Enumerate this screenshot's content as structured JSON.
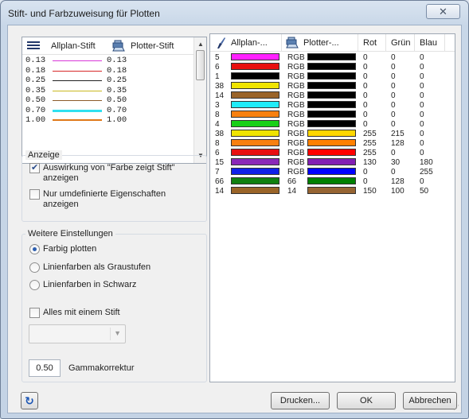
{
  "window": {
    "title": "Stift- und Farbzuweisung für Plotten",
    "close_glyph": "✕"
  },
  "pen_list": {
    "col_allplan": "Allplan-Stift",
    "col_plotter": "Plotter-Stift",
    "rows": [
      {
        "a": "0.13",
        "b": "0.13",
        "color": "#d838d8",
        "w": 1
      },
      {
        "a": "0.18",
        "b": "0.18",
        "color": "#d82828",
        "w": 1
      },
      {
        "a": "0.25",
        "b": "0.25",
        "color": "#222222",
        "w": 1
      },
      {
        "a": "0.35",
        "b": "0.35",
        "color": "#c8b820",
        "w": 1
      },
      {
        "a": "0.50",
        "b": "0.50",
        "color": "#8b5a2b",
        "w": 1
      },
      {
        "a": "0.70",
        "b": "0.70",
        "color": "#30e0f0",
        "w": 3
      },
      {
        "a": "1.00",
        "b": "1.00",
        "color": "#e07818",
        "w": 2
      }
    ]
  },
  "display_group": {
    "title": "Anzeige",
    "opt1": "Auswirkung von \"Farbe zeigt Stift\"",
    "opt1b": "anzeigen",
    "opt1_checked": true,
    "opt2": "Nur umdefinierte Eigenschaften",
    "opt2b": "anzeigen",
    "opt2_checked": false
  },
  "settings_group": {
    "title": "Weitere Einstellungen",
    "radio1": "Farbig plotten",
    "radio2": "Linienfarben als Graustufen",
    "radio3": "Linienfarben in Schwarz",
    "selected": "Farbig plotten",
    "single_pen": "Alles mit einem Stift",
    "gamma_value": "0.50",
    "gamma_label": "Gammakorrektur"
  },
  "table": {
    "headers": {
      "allplan": "Allplan-...",
      "plotter": "Plotter-...",
      "rot": "Rot",
      "gruen": "Grün",
      "blau": "Blau"
    },
    "rows": [
      {
        "pen": "5",
        "color": "#ff20ff",
        "mode": "RGB",
        "pcolor": "#000000",
        "r": "0",
        "g": "0",
        "b": "0"
      },
      {
        "pen": "6",
        "color": "#e81010",
        "mode": "RGB",
        "pcolor": "#000000",
        "r": "0",
        "g": "0",
        "b": "0"
      },
      {
        "pen": "1",
        "color": "#000000",
        "mode": "RGB",
        "pcolor": "#000000",
        "r": "0",
        "g": "0",
        "b": "0"
      },
      {
        "pen": "38",
        "color": "#f0e400",
        "mode": "RGB",
        "pcolor": "#000000",
        "r": "0",
        "g": "0",
        "b": "0"
      },
      {
        "pen": "14",
        "color": "#9a6428",
        "mode": "RGB",
        "pcolor": "#000000",
        "r": "0",
        "g": "0",
        "b": "0"
      },
      {
        "pen": "3",
        "color": "#20ecf8",
        "mode": "RGB",
        "pcolor": "#000000",
        "r": "0",
        "g": "0",
        "b": "0"
      },
      {
        "pen": "8",
        "color": "#f88010",
        "mode": "RGB",
        "pcolor": "#000000",
        "r": "0",
        "g": "0",
        "b": "0"
      },
      {
        "pen": "4",
        "color": "#18d018",
        "mode": "RGB",
        "pcolor": "#000000",
        "r": "0",
        "g": "0",
        "b": "0"
      },
      {
        "pen": "38",
        "color": "#f0e400",
        "mode": "RGB",
        "pcolor": "#ffd700",
        "r": "255",
        "g": "215",
        "b": "0"
      },
      {
        "pen": "8",
        "color": "#f88010",
        "mode": "RGB",
        "pcolor": "#ff8000",
        "r": "255",
        "g": "128",
        "b": "0"
      },
      {
        "pen": "6",
        "color": "#e81010",
        "mode": "RGB",
        "pcolor": "#ff0000",
        "r": "255",
        "g": "0",
        "b": "0"
      },
      {
        "pen": "15",
        "color": "#8a28b8",
        "mode": "RGB",
        "pcolor": "#821eb4",
        "r": "130",
        "g": "30",
        "b": "180"
      },
      {
        "pen": "7",
        "color": "#1020e8",
        "mode": "RGB",
        "pcolor": "#0000ff",
        "r": "0",
        "g": "0",
        "b": "255"
      },
      {
        "pen": "66",
        "color": "#108010",
        "mode": "66",
        "pcolor": "#008000",
        "r": "0",
        "g": "128",
        "b": "0"
      },
      {
        "pen": "14",
        "color": "#9a6428",
        "mode": "14",
        "pcolor": "#966432",
        "r": "150",
        "g": "100",
        "b": "50"
      }
    ]
  },
  "buttons": {
    "print": "Drucken...",
    "ok": "OK",
    "cancel": "Abbrechen"
  }
}
